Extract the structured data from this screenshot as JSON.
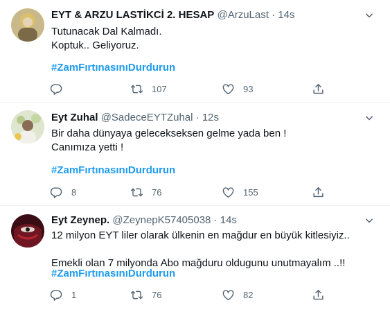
{
  "tweets": [
    {
      "name": "EYT & ARZU LASTİKCİ 2. HESAP",
      "handle": "@ArzuLast",
      "separator": "·",
      "time": "14s",
      "text": "Tutunacak Dal Kalmadı.\nKoptuk.. Geliyoruz.",
      "hashtag": "#ZamFırtınasınıDurdurun",
      "replies": "",
      "retweets": "107",
      "likes": "93"
    },
    {
      "name": "Eyt Zuhal",
      "handle": "@SadeceEYTZuhal",
      "separator": "·",
      "time": "12s",
      "text": "Bir daha dünyaya gelecekseksen gelme yada ben !\nCanımıza yetti !",
      "hashtag": "#ZamFırtınasınıDurdurun",
      "replies": "8",
      "retweets": "76",
      "likes": "155"
    },
    {
      "name": "Eyt Zeynep.",
      "handle": "@ZeynepK57405038",
      "separator": "·",
      "time": "14s",
      "text": "12 milyon EYT liler olarak ülkenin en mağdur en büyük kitlesiyiz..\n\nEmekli olan 7 milyonda Abo mağduru oldugunu unutmayalım ..!!",
      "hashtag": "#ZamFırtınasınıDurdurun",
      "replies": "1",
      "retweets": "76",
      "likes": "82"
    }
  ],
  "icons": {
    "reply": "reply-icon",
    "retweet": "retweet-icon",
    "like": "heart-icon",
    "share": "share-icon",
    "more": "more-caret-icon"
  },
  "colors": {
    "hashtag": "#1d9bf0",
    "secondary_text": "#536471",
    "divider": "#eff3f4"
  }
}
